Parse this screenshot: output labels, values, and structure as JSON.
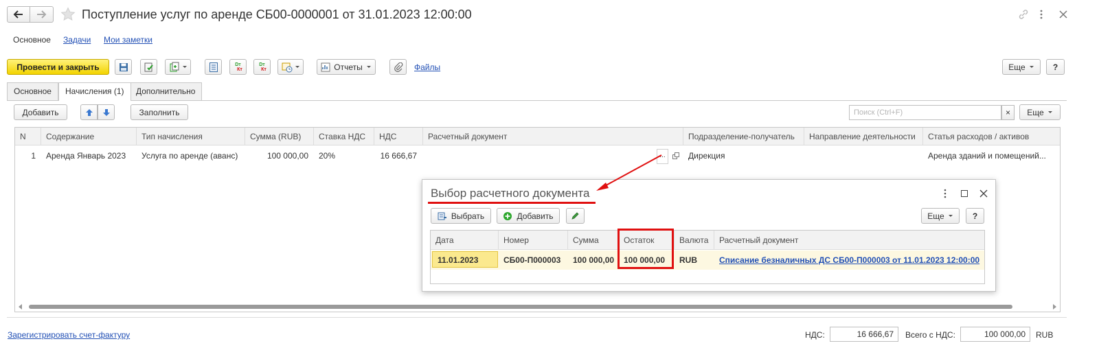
{
  "window": {
    "title": "Поступление услуг по аренде СБ00-0000001 от 31.01.2023 12:00:00",
    "nav_tabs": [
      "Основное",
      "Задачи",
      "Мои заметки"
    ]
  },
  "toolbar": {
    "post_close": "Провести и закрыть",
    "reports": "Отчеты",
    "files": "Файлы",
    "more": "Еще",
    "help": "?",
    "dt_kt_top": "Dт",
    "dt_kt_bottom": "Кт"
  },
  "form_tabs": [
    "Основное",
    "Начисления (1)",
    "Дополнительно"
  ],
  "table_toolbar": {
    "add": "Добавить",
    "fill": "Заполнить",
    "search_placeholder": "Поиск (Ctrl+F)",
    "clear": "×",
    "more": "Еще"
  },
  "table": {
    "headers": [
      "N",
      "Содержание",
      "Тип начисления",
      "Сумма (RUB)",
      "Ставка НДС",
      "НДС",
      "Расчетный документ",
      "Подразделение-получатель",
      "Направление деятельности",
      "Статья расходов / активов"
    ],
    "rows": [
      [
        "1",
        "Аренда Январь 2023",
        "Услуга по аренде (аванс)",
        "100 000,00",
        "20%",
        "16 666,67",
        "",
        "Дирекция",
        "",
        "Аренда зданий и помещений..."
      ]
    ],
    "ellipsis": "..."
  },
  "dialog": {
    "title": "Выбор расчетного документа",
    "select": "Выбрать",
    "add": "Добавить",
    "more": "Еще",
    "help": "?",
    "headers": [
      "Дата",
      "Номер",
      "Сумма",
      "Остаток",
      "Валюта",
      "Расчетный документ"
    ],
    "rows": [
      [
        "11.01.2023",
        "СБ00-П000003",
        "100 000,00",
        "100 000,00",
        "RUB",
        "Списание безналичных ДС СБ00-П000003 от 11.01.2023 12:00:00"
      ]
    ]
  },
  "footer": {
    "register_link": "Зарегистрировать счет-фактуру",
    "vat_label": "НДС:",
    "vat_value": "16 666,67",
    "total_label": "Всего с НДС:",
    "total_value": "100 000,00",
    "currency": "RUB"
  },
  "colors": {
    "primary_button": "#f2d300",
    "link": "#2250b5",
    "annotation": "#e01010"
  }
}
